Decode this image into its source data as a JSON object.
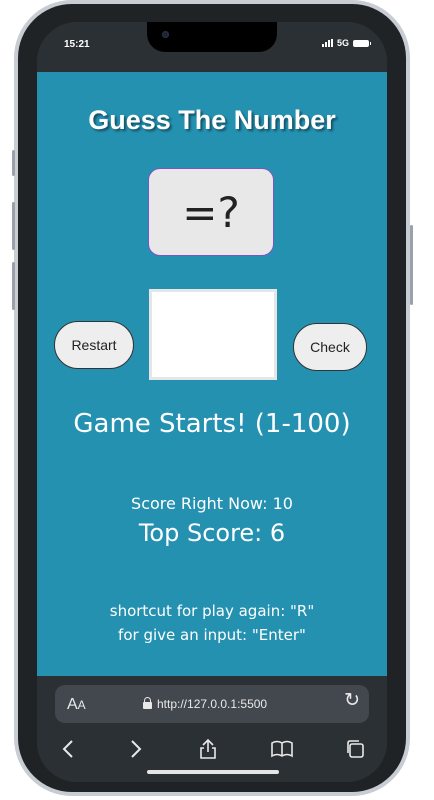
{
  "status_bar": {
    "time": "15:21",
    "network": "5G"
  },
  "game": {
    "title": "Guess The Number",
    "display": "=?",
    "restart_label": "Restart",
    "check_label": "Check",
    "guess_value": "",
    "message": "Game Starts! (1-100)",
    "score_now": "Score Right Now: 10",
    "top_score": "Top Score: 6",
    "hint_again": "shortcut for play again: \"R\"",
    "hint_input": "for give an input: \"Enter\""
  },
  "browser": {
    "text_size_label": "A",
    "text_size_label_small": "A",
    "url": "http://127.0.0.1:5500"
  },
  "colors": {
    "page_background": "#2491b1",
    "number_box": "#e8e8e8",
    "number_box_border": "#7a55c9",
    "button": "#eeeeee"
  },
  "icons": [
    "back-arrow-icon",
    "forward-arrow-icon",
    "share-icon",
    "bookmarks-icon",
    "tabs-icon",
    "reload-icon",
    "lock-icon"
  ]
}
